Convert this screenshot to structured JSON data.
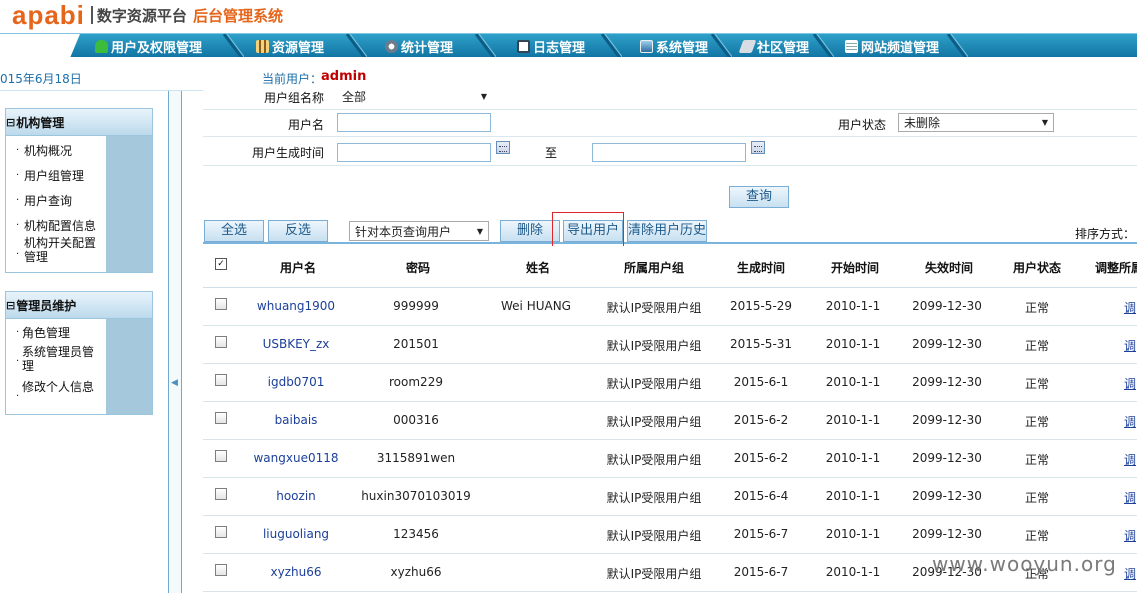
{
  "header": {
    "logo_mark": "apabi",
    "logo_platform": "数字资源平台",
    "logo_sub": "后台管理系统"
  },
  "nav": {
    "items": [
      {
        "label": "用户及权限管理",
        "icon": "user-icon"
      },
      {
        "label": "资源管理",
        "icon": "resource-icon"
      },
      {
        "label": "统计管理",
        "icon": "stats-icon"
      },
      {
        "label": "日志管理",
        "icon": "log-icon"
      },
      {
        "label": "系统管理",
        "icon": "monitor-icon"
      },
      {
        "label": "社区管理",
        "icon": "community-icon"
      },
      {
        "label": "网站频道管理",
        "icon": "grid-icon"
      }
    ]
  },
  "info": {
    "date": "015年6月18日",
    "current_user_label": "当前用户：",
    "current_user": "admin"
  },
  "sidebar": {
    "org": {
      "title": "机构管理",
      "toggle": "⊟",
      "items": [
        "机构概况",
        "用户组管理",
        "用户查询",
        "机构配置信息",
        "机构开关配置管理"
      ]
    },
    "admin": {
      "title": "管理员维护",
      "toggle": "⊟",
      "items": [
        "角色管理",
        "系统管理员管理",
        "修改个人信息"
      ]
    }
  },
  "form": {
    "group_label": "用户组名称",
    "group_value": "全部",
    "username_label": "用户名",
    "username_value": "",
    "status_label": "用户状态",
    "status_value": "未删除",
    "created_label": "用户生成时间",
    "to_label": "至",
    "created_from": "",
    "created_to": ""
  },
  "buttons": {
    "query": "查询",
    "select_all": "全选",
    "invert": "反选",
    "scope_select": "针对本页查询用户",
    "delete": "删除",
    "export": "导出用户",
    "clear_history": "清除用户历史",
    "sort_label": "排序方式："
  },
  "table": {
    "headers": [
      "用户名",
      "密码",
      "姓名",
      "所属用户组",
      "生成时间",
      "开始时间",
      "失效时间",
      "用户状态",
      "调整所属"
    ],
    "adjust_text": "调",
    "rows": [
      {
        "username": "whuang1900",
        "password": "999999",
        "name": "Wei HUANG",
        "group": "默认IP受限用户组",
        "created": "2015-5-29",
        "start": "2010-1-1",
        "expire": "2099-12-30",
        "status": "正常"
      },
      {
        "username": "USBKEY_zx",
        "password": "201501",
        "name": "",
        "group": "默认IP受限用户组",
        "created": "2015-5-31",
        "start": "2010-1-1",
        "expire": "2099-12-30",
        "status": "正常"
      },
      {
        "username": "igdb0701",
        "password": "room229",
        "name": "",
        "group": "默认IP受限用户组",
        "created": "2015-6-1",
        "start": "2010-1-1",
        "expire": "2099-12-30",
        "status": "正常"
      },
      {
        "username": "baibais",
        "password": "000316",
        "name": "",
        "group": "默认IP受限用户组",
        "created": "2015-6-2",
        "start": "2010-1-1",
        "expire": "2099-12-30",
        "status": "正常"
      },
      {
        "username": "wangxue0118",
        "password": "3115891wen",
        "name": "",
        "group": "默认IP受限用户组",
        "created": "2015-6-2",
        "start": "2010-1-1",
        "expire": "2099-12-30",
        "status": "正常"
      },
      {
        "username": "hoozin",
        "password": "huxin3070103019",
        "name": "",
        "group": "默认IP受限用户组",
        "created": "2015-6-4",
        "start": "2010-1-1",
        "expire": "2099-12-30",
        "status": "正常"
      },
      {
        "username": "liuguoliang",
        "password": "123456",
        "name": "",
        "group": "默认IP受限用户组",
        "created": "2015-6-7",
        "start": "2010-1-1",
        "expire": "2099-12-30",
        "status": "正常"
      },
      {
        "username": "xyzhu66",
        "password": "xyzhu66",
        "name": "",
        "group": "默认IP受限用户组",
        "created": "2015-6-7",
        "start": "2010-1-1",
        "expire": "2099-12-30",
        "status": "正常"
      }
    ]
  },
  "watermark": "www.wooyun.org",
  "colors": {
    "nav": "#1b86b5",
    "brand": "#e6651a",
    "link": "#1b3f9a",
    "user": "#c00000",
    "highlight": "#e0262b"
  }
}
